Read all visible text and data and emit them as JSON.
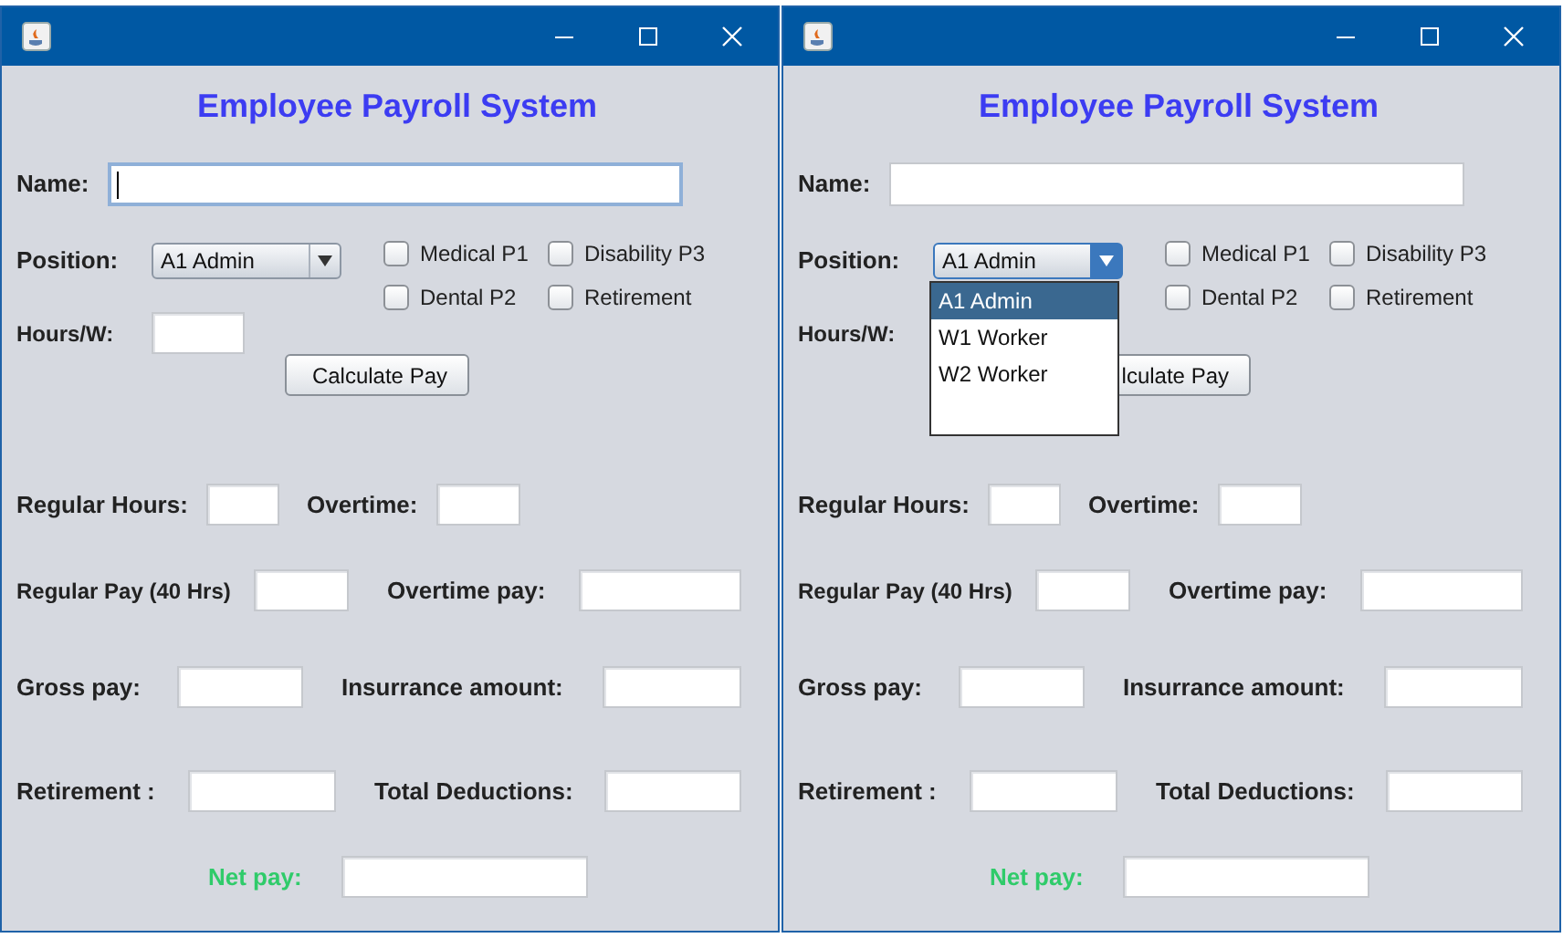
{
  "windows": [
    {
      "heading": "Employee Payroll System",
      "name": {
        "label": "Name:",
        "focused": true
      },
      "position": {
        "label": "Position:",
        "value": "A1 Admin",
        "focused": false,
        "open": false
      },
      "benefits": [
        {
          "label": "Medical P1",
          "checked": false
        },
        {
          "label": "Disability P3",
          "checked": false
        },
        {
          "label": "Dental P2",
          "checked": false
        },
        {
          "label": "Retirement",
          "checked": false
        }
      ],
      "hours": {
        "label": "Hours/W:"
      },
      "button": "Calculate Pay",
      "rows": [
        {
          "left": "Regular Hours:",
          "right": "Overtime:"
        },
        {
          "left": "Regular Pay (40 Hrs)",
          "right": "Overtime pay:"
        },
        {
          "left": "Gross pay:",
          "right": "Insurrance amount:"
        },
        {
          "left": "Retirement :",
          "right": "Total Deductions:"
        }
      ],
      "net": "Net pay:"
    },
    {
      "heading": "Employee Payroll System",
      "name": {
        "label": "Name:",
        "focused": false
      },
      "position": {
        "label": "Position:",
        "value": "A1 Admin",
        "focused": true,
        "open": true,
        "options": [
          {
            "label": "A1 Admin",
            "selected": true
          },
          {
            "label": "W1 Worker",
            "selected": false
          },
          {
            "label": "W2 Worker",
            "selected": false
          }
        ]
      },
      "benefits": [
        {
          "label": "Medical P1",
          "checked": false
        },
        {
          "label": "Disability P3",
          "checked": false
        },
        {
          "label": "Dental P2",
          "checked": false
        },
        {
          "label": "Retirement",
          "checked": false
        }
      ],
      "hours": {
        "label": "Hours/W:"
      },
      "button": "lculate Pay",
      "rows": [
        {
          "left": "Regular Hours:",
          "right": "Overtime:"
        },
        {
          "left": "Regular Pay (40 Hrs)",
          "right": "Overtime pay:"
        },
        {
          "left": "Gross pay:",
          "right": "Insurrance amount:"
        },
        {
          "left": "Retirement :",
          "right": "Total Deductions:"
        }
      ],
      "net": "Net pay:"
    }
  ]
}
